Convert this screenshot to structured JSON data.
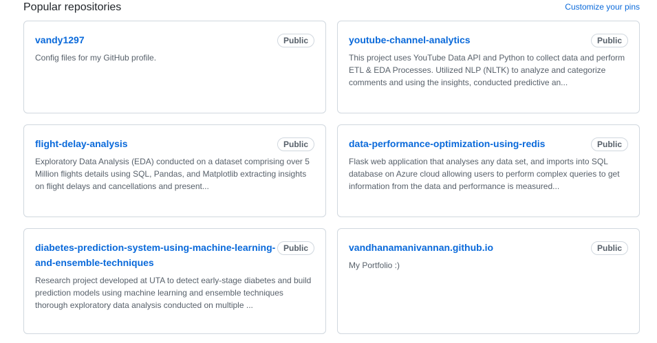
{
  "section": {
    "title": "Popular repositories",
    "customize_label": "Customize your pins"
  },
  "repos": [
    {
      "name": "vandy1297",
      "visibility": "Public",
      "description": "Config files for my GitHub profile."
    },
    {
      "name": "youtube-channel-analytics",
      "visibility": "Public",
      "description": "This project uses YouTube Data API and Python to collect data and perform ETL & EDA Processes. Utilized NLP (NLTK) to analyze and categorize comments and using the insights, conducted predictive an..."
    },
    {
      "name": "flight-delay-analysis",
      "visibility": "Public",
      "description": "Exploratory Data Analysis (EDA) conducted on a dataset comprising over 5 Million flights details using SQL, Pandas, and Matplotlib extracting insights on flight delays and cancellations and present..."
    },
    {
      "name": "data-performance-optimization-using-redis",
      "visibility": "Public",
      "description": "Flask web application that analyses any data set, and imports into SQL database on Azure cloud allowing users to perform complex queries to get information from the data and performance is measured..."
    },
    {
      "name": "diabetes-prediction-system-using-machine-learning-and-ensemble-techniques",
      "visibility": "Public",
      "description": "Research project developed at UTA to detect early-stage diabetes and build prediction models using machine learning and ensemble techniques thorough exploratory data analysis conducted on multiple ..."
    },
    {
      "name": "vandhanamanivannan.github.io",
      "visibility": "Public",
      "description": "My Portfolio :)"
    }
  ]
}
